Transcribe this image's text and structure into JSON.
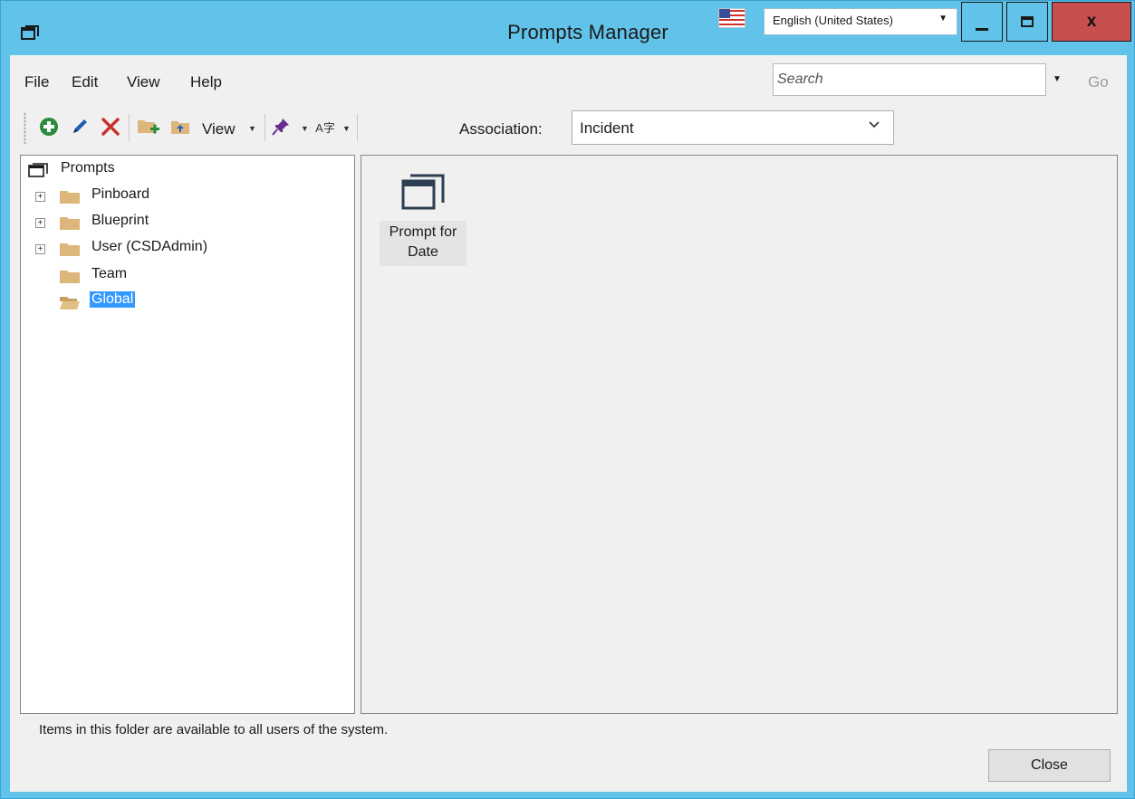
{
  "window": {
    "title": "Prompts Manager",
    "language": "English (United States)",
    "close_label": "x"
  },
  "menu": {
    "items": [
      "File",
      "Edit",
      "View",
      "Help"
    ]
  },
  "search": {
    "placeholder": "Search",
    "go_label": "Go"
  },
  "toolbar": {
    "view_label": "View",
    "association_label": "Association:",
    "association_value": "Incident",
    "icons": [
      "add-icon",
      "edit-pencil-icon",
      "delete-x-icon",
      "new-folder-icon",
      "move-folder-icon",
      "pin-icon",
      "translate-icon"
    ]
  },
  "tree": {
    "root": "Prompts",
    "items": [
      {
        "label": "Pinboard",
        "expandable": true
      },
      {
        "label": "Blueprint",
        "expandable": true
      },
      {
        "label": "User (CSDAdmin)",
        "expandable": true
      },
      {
        "label": "Team",
        "expandable": false
      },
      {
        "label": "Global",
        "expandable": false,
        "selected": true
      }
    ]
  },
  "content": {
    "items": [
      {
        "line1": "Prompt for",
        "line2": "Date"
      }
    ]
  },
  "status": {
    "text": "Items in this folder are available to all users of the system."
  },
  "footer": {
    "close_label": "Close"
  },
  "colors": {
    "titlebar": "#62c3ea",
    "close_button": "#c7504f",
    "selection": "#3399ff",
    "folder": "#dcb67a"
  }
}
